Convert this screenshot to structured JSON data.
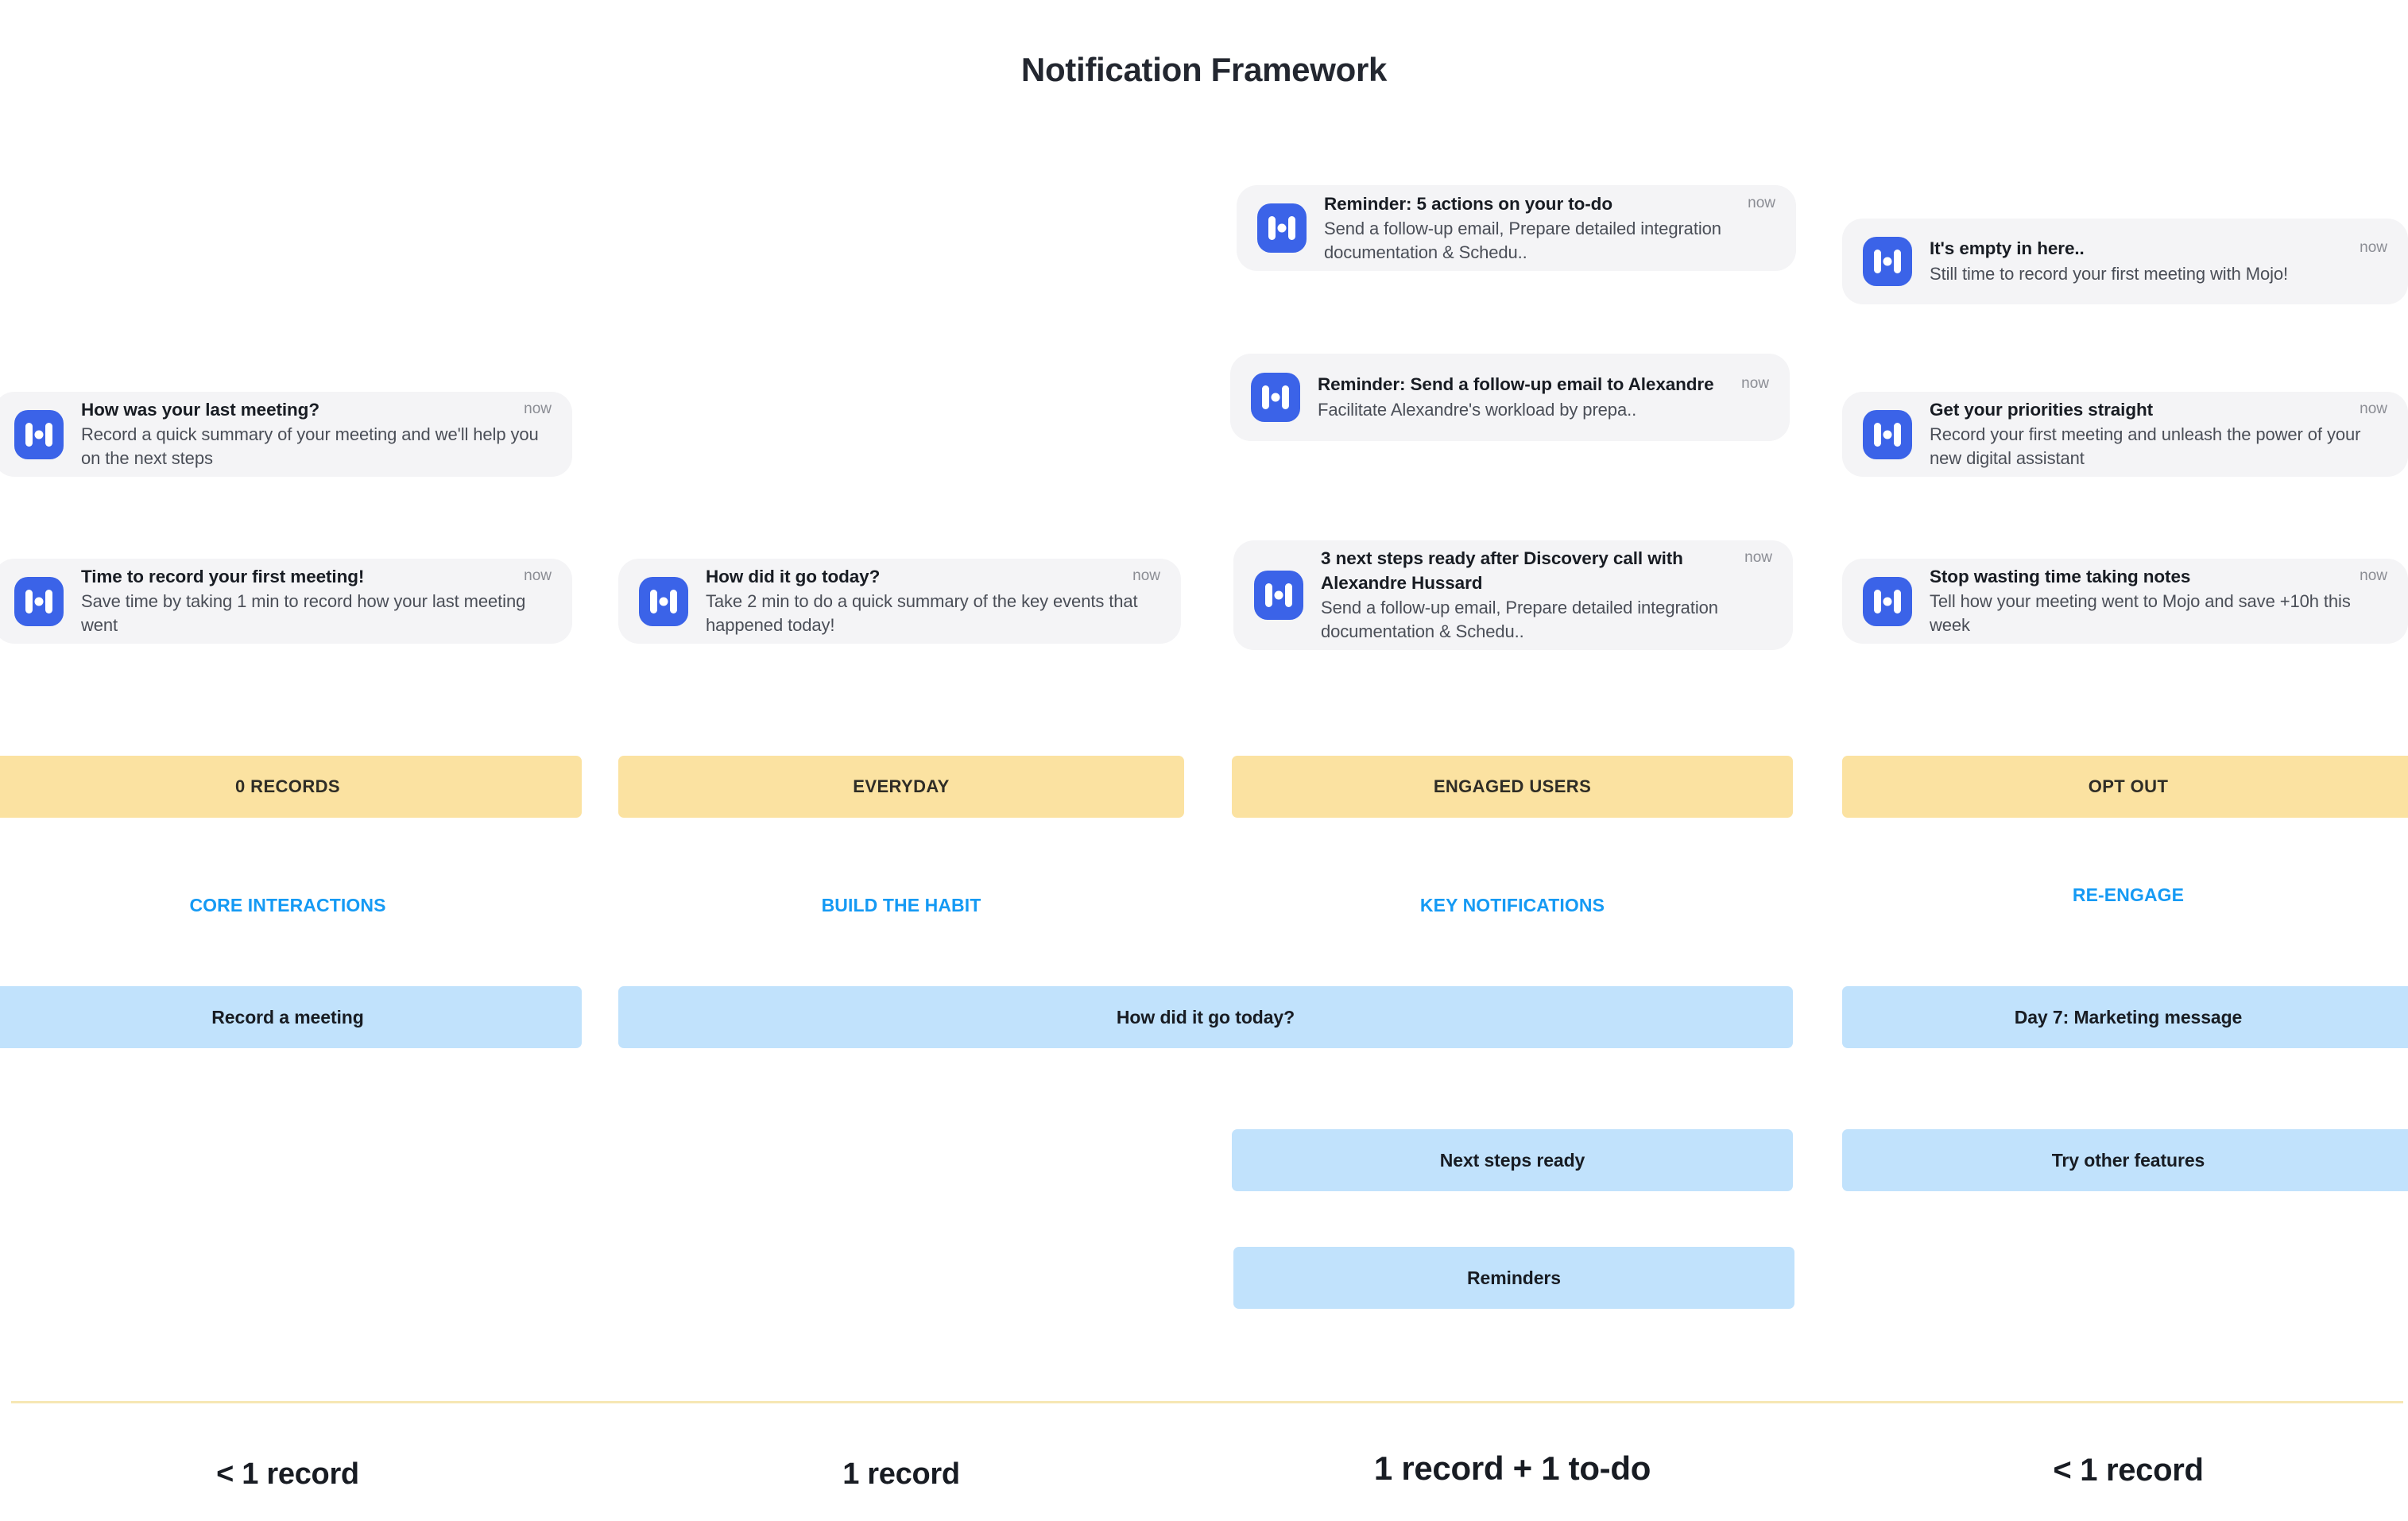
{
  "page": {
    "title": "Notification Framework",
    "accent_blue": "#159af4",
    "stage_yellow": "#fbe2a1",
    "action_blue": "#c1e2fc",
    "app_icon_blue": "#3b63e8",
    "card_bg": "#f4f4f6",
    "divider_color": "#f6e7b4"
  },
  "notifications": [
    {
      "id": "how-was-your-last-meeting",
      "title": "How was your last meeting?",
      "desc": "Record a quick summary of your meeting and we'll help you on the next steps",
      "time": "now",
      "icon": "mojo-app-icon"
    },
    {
      "id": "time-to-record-first-meeting",
      "title": "Time to record your first meeting!",
      "desc": "Save time by taking 1 min to record how your last meeting went",
      "time": "now",
      "icon": "mojo-app-icon"
    },
    {
      "id": "how-did-it-go-today",
      "title": "How did it go today?",
      "desc": "Take 2 min to do a quick summary of the key events that happened today!",
      "time": "now",
      "icon": "mojo-app-icon"
    },
    {
      "id": "reminder-5-actions-todo",
      "title": "Reminder: 5 actions on your to-do",
      "desc": "Send a follow-up email, Prepare detailed integration documentation & Schedu..",
      "time": "now",
      "icon": "mojo-app-icon"
    },
    {
      "id": "reminder-send-followup-alexandre",
      "title": "Reminder: Send a follow-up email to Alexandre",
      "desc": "Facilitate Alexandre's workload by prepa..",
      "time": "now",
      "icon": "mojo-app-icon"
    },
    {
      "id": "3-next-steps-discovery-call",
      "title": "3 next steps ready after Discovery call with Alexandre Hussard",
      "desc": "Send a follow-up email, Prepare detailed integration documentation & Schedu..",
      "time": "now",
      "icon": "mojo-app-icon"
    },
    {
      "id": "its-empty-in-here",
      "title": "It's empty in here..",
      "desc": "Still time to record your first meeting with Mojo!",
      "time": "now",
      "icon": "mojo-app-icon"
    },
    {
      "id": "get-your-priorities-straight",
      "title": "Get your priorities straight",
      "desc": "Record your first meeting and unleash the power of your new digital assistant",
      "time": "now",
      "icon": "mojo-app-icon"
    },
    {
      "id": "stop-wasting-time-taking-notes",
      "title": "Stop wasting time taking notes",
      "desc": "Tell how your meeting went to Mojo and save +10h this week",
      "time": "now",
      "icon": "mojo-app-icon"
    }
  ],
  "stages": [
    {
      "id": "0-records",
      "label": "0 RECORDS"
    },
    {
      "id": "everyday",
      "label": "EVERYDAY"
    },
    {
      "id": "engaged-users",
      "label": "ENGAGED USERS"
    },
    {
      "id": "opt-out",
      "label": "OPT OUT"
    }
  ],
  "sections": [
    {
      "id": "core-interactions",
      "label": "CORE INTERACTIONS"
    },
    {
      "id": "build-the-habit",
      "label": "BUILD THE HABIT"
    },
    {
      "id": "key-notifications",
      "label": "KEY NOTIFICATIONS"
    },
    {
      "id": "re-engage",
      "label": "RE-ENGAGE"
    }
  ],
  "actions": [
    {
      "id": "record-a-meeting",
      "label": "Record a meeting"
    },
    {
      "id": "how-did-it-go-today",
      "label": "How did it go today?"
    },
    {
      "id": "day-7-marketing",
      "label": "Day 7: Marketing message"
    },
    {
      "id": "next-steps-ready",
      "label": "Next steps ready"
    },
    {
      "id": "try-other-features",
      "label": "Try other features"
    },
    {
      "id": "reminders",
      "label": "Reminders"
    }
  ],
  "footer": [
    {
      "id": "col1-records",
      "label": "< 1 record"
    },
    {
      "id": "col2-records",
      "label": "1 record"
    },
    {
      "id": "col3-records",
      "label": "1 record + 1 to-do"
    },
    {
      "id": "col4-records",
      "label": "< 1 record"
    }
  ]
}
